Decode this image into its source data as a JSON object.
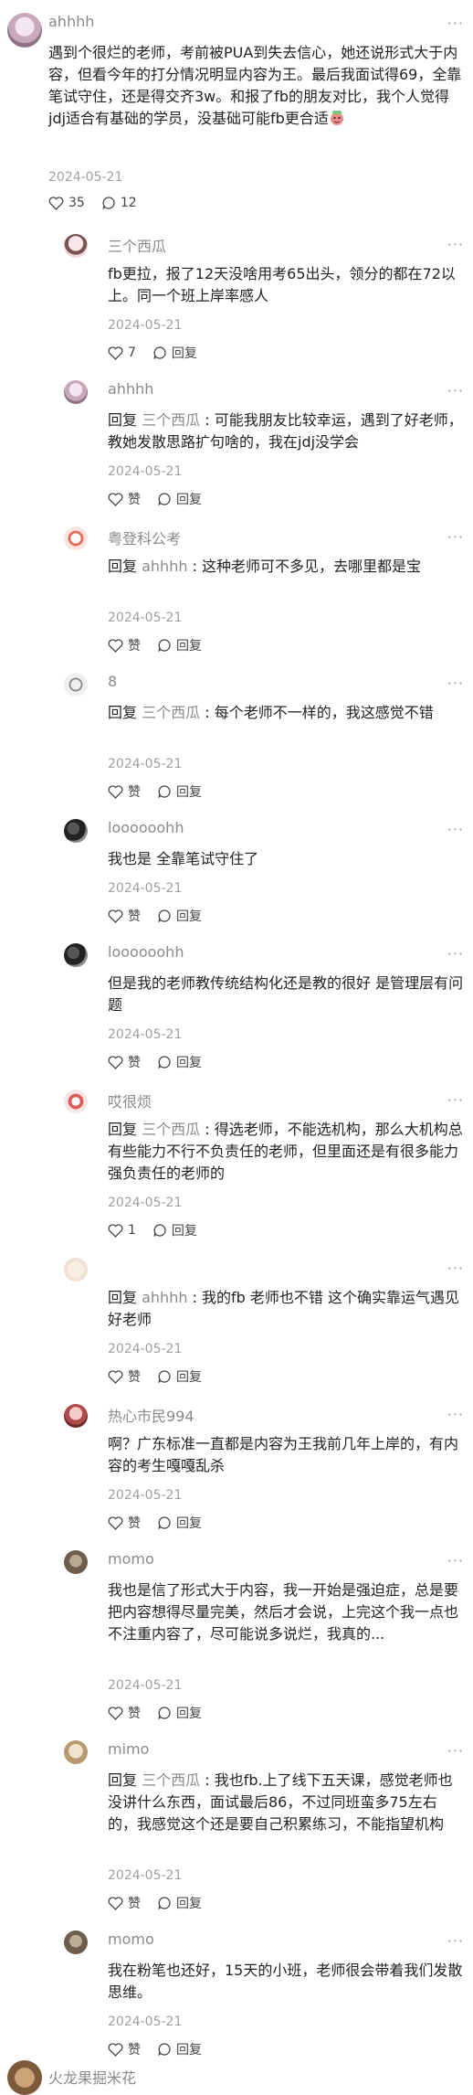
{
  "main_comment": {
    "user": "ahhhh",
    "text": "遇到个很烂的老师，考前被PUA到失去信心，她还说形式大于内容，但看今年的打分情况明显内容为王。最后我面试得69，全靠笔试守住，还是得交齐3w。和报了fb的朋友对比，我个人觉得jdj适合有基础的学员，没基础可能fb更合适",
    "date": "2024-05-21",
    "likes": "35",
    "replies": "12"
  },
  "reply_prefix": "回复",
  "reply_label": "回复",
  "like_label": "赞",
  "more_label": "···",
  "replies": [
    {
      "user": "三个西瓜",
      "reply_to": "",
      "text": "fb更拉，报了12天没啥用考65出头，领分的都在72以上。同一个班上岸率感人",
      "date": "2024-05-21",
      "likes": "7"
    },
    {
      "user": "ahhhh",
      "reply_to": "三个西瓜",
      "text": "可能我朋友比较幸运，遇到了好老师，教她发散思路扩句啥的，我在jdj没学会",
      "date": "2024-05-21",
      "likes": "赞"
    },
    {
      "user": "粤登科公考",
      "reply_to": "ahhhh",
      "text": "这种老师可不多见，去哪里都是宝",
      "date": "2024-05-21",
      "likes": "赞"
    },
    {
      "user": "8",
      "reply_to": "三个西瓜",
      "text": "每个老师不一样的，我这感觉不错",
      "date": "2024-05-21",
      "likes": "赞"
    },
    {
      "user": "loooooohh",
      "reply_to": "",
      "text": "我也是 全靠笔试守住了",
      "date": "2024-05-21",
      "likes": "赞"
    },
    {
      "user": "loooooohh",
      "reply_to": "",
      "text": "但是我的老师教传统结构化还是教的很好 是管理层有问题",
      "date": "2024-05-21",
      "likes": "赞"
    },
    {
      "user": "哎很烦",
      "reply_to": "三个西瓜",
      "text": "得选老师，不能选机构，那么大机构总有些能力不行不负责任的老师，但里面还是有很多能力强负责任的老师的",
      "date": "2024-05-21",
      "likes": "1"
    },
    {
      "user": "",
      "reply_to": "ahhhh",
      "text": "我的fb 老师也不错 这个确实靠运气遇见好老师",
      "date": "2024-05-21",
      "likes": "赞"
    },
    {
      "user": "热心市民994",
      "reply_to": "",
      "text": "啊？广东标准一直都是内容为王我前几年上岸的，有内容的考生嘎嘎乱杀",
      "date": "2024-05-21",
      "likes": "赞"
    },
    {
      "user": "momo",
      "reply_to": "",
      "text": "我也是信了形式大于内容，我一开始是强迫症，总是要把内容想得尽量完美，然后才会说，上完这个我一点也不注重内容了，尽可能说多说烂，我真的...",
      "date": "2024-05-21",
      "likes": "赞"
    },
    {
      "user": "mimo",
      "reply_to": "三个西瓜",
      "text": "我也fb.上了线下五天课，感觉老师也没讲什么东西，面试最后86，不过同班蛮多75左右的，我感觉这个还是要自己积累练习，不能指望机构",
      "date": "2024-05-21",
      "likes": "赞"
    },
    {
      "user": "momo",
      "reply_to": "",
      "text": "我在粉笔也还好，15天的小班，老师很会带着我们发散思维。",
      "date": "2024-05-21",
      "likes": "赞"
    }
  ],
  "next_comment": {
    "user": "火龙果掘米花"
  },
  "colors": {
    "accent": "#e4453a",
    "date": "#a0a0a0",
    "name": "#8a8a8a"
  }
}
